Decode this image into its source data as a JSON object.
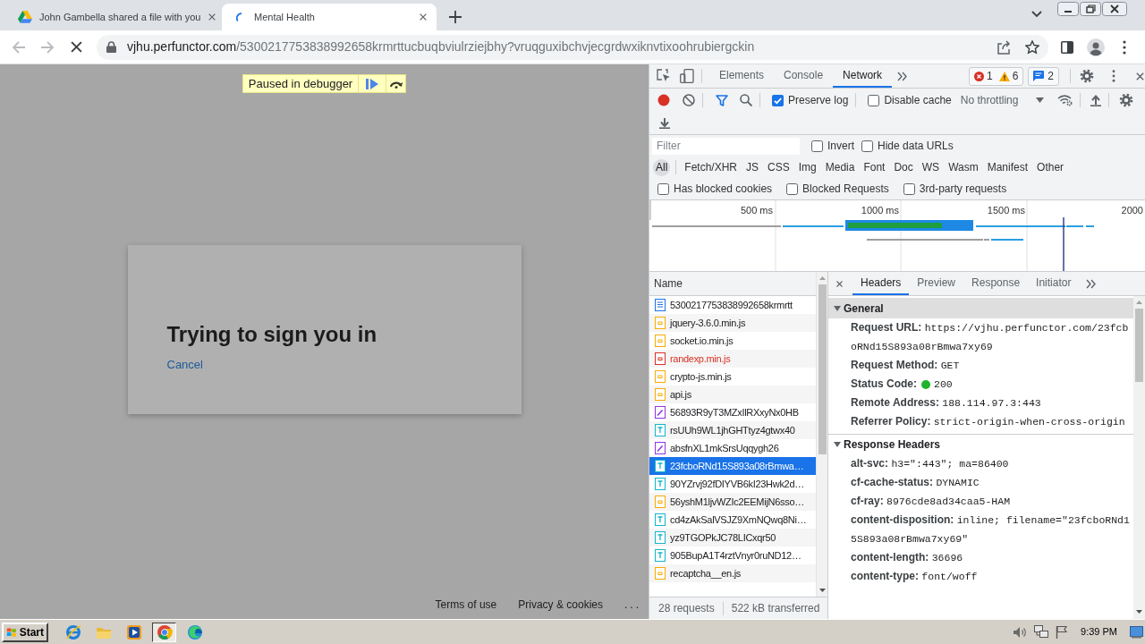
{
  "browser": {
    "tabs": [
      {
        "title": "John Gambella shared a file with you",
        "selected": false,
        "loading": false
      },
      {
        "title": "Mental Health",
        "selected": true,
        "loading": true
      }
    ],
    "loading": true,
    "address": {
      "host": "vjhu.perfunctor.com",
      "path": "/5300217753838992658krmrttucbuqbviulrziejbhy?vruqguxibchvjecgrdwxiknvtixoohrubiergckin"
    }
  },
  "page": {
    "debugger_banner": "Paused in debugger",
    "dialog": {
      "title": "Trying to sign you in",
      "link": "Cancel"
    },
    "footer": {
      "links": [
        "Terms of use",
        "Privacy & cookies"
      ],
      "more": "..."
    }
  },
  "devtools": {
    "tabs": [
      {
        "label": "Elements",
        "selected": false
      },
      {
        "label": "Console",
        "selected": false
      },
      {
        "label": "Network",
        "selected": true
      }
    ],
    "counts": {
      "errors": "1",
      "warnings": "6",
      "messages": "2"
    },
    "toolbar": {
      "recording": true,
      "options": [
        {
          "label": "Preserve log",
          "checked": true
        },
        {
          "label": "Disable cache",
          "checked": false
        }
      ],
      "throttling": "No throttling"
    },
    "filter": {
      "placeholder": "Filter",
      "options": [
        {
          "label": "Invert",
          "checked": false
        },
        {
          "label": "Hide data URLs",
          "checked": false
        }
      ]
    },
    "types": [
      {
        "label": "All",
        "selected": true
      },
      {
        "label": "Fetch/XHR",
        "selected": false
      },
      {
        "label": "JS",
        "selected": false
      },
      {
        "label": "CSS",
        "selected": false
      },
      {
        "label": "Img",
        "selected": false
      },
      {
        "label": "Media",
        "selected": false
      },
      {
        "label": "Font",
        "selected": false
      },
      {
        "label": "Doc",
        "selected": false
      },
      {
        "label": "WS",
        "selected": false
      },
      {
        "label": "Wasm",
        "selected": false
      },
      {
        "label": "Manifest",
        "selected": false
      },
      {
        "label": "Other",
        "selected": false
      }
    ],
    "request_filters": [
      {
        "label": "Has blocked cookies",
        "checked": false
      },
      {
        "label": "Blocked Requests",
        "checked": false
      },
      {
        "label": "3rd-party requests",
        "checked": false
      }
    ],
    "overview": {
      "ticks": [
        "500 ms",
        "1000 ms",
        "1500 ms",
        "2000"
      ]
    },
    "requests": {
      "column": "Name",
      "rows": [
        {
          "name": "5300217753838992658krmrtt",
          "kind": "document",
          "failed": false,
          "selected": false
        },
        {
          "name": "jquery-3.6.0.min.js",
          "kind": "script",
          "failed": false,
          "selected": false
        },
        {
          "name": "socket.io.min.js",
          "kind": "script",
          "failed": false,
          "selected": false
        },
        {
          "name": "randexp.min.js",
          "kind": "script",
          "failed": true,
          "selected": false
        },
        {
          "name": "crypto-js.min.js",
          "kind": "script",
          "failed": false,
          "selected": false
        },
        {
          "name": "api.js",
          "kind": "script",
          "failed": false,
          "selected": false
        },
        {
          "name": "56893R9yT3MZxIlRXxyNx0HB",
          "kind": "other",
          "failed": false,
          "selected": false
        },
        {
          "name": "rsUUh9WL1jhGHTtyz4gtwx40",
          "kind": "font",
          "failed": false,
          "selected": false
        },
        {
          "name": "absfnXL1mkSrsUqqygh26",
          "kind": "other",
          "failed": false,
          "selected": false
        },
        {
          "name": "23fcboRNd15S893a08rBmwa…",
          "kind": "font",
          "failed": false,
          "selected": true
        },
        {
          "name": "90YZrvj92fDIYVB6kI23Hwk2d…",
          "kind": "font",
          "failed": false,
          "selected": false
        },
        {
          "name": "56yshM1ljvWZIc2EEMijN6sso…",
          "kind": "script",
          "failed": false,
          "selected": false
        },
        {
          "name": "cd4zAkSalVSJZ9XmNQwq8Ni…",
          "kind": "font",
          "failed": false,
          "selected": false
        },
        {
          "name": "yz9TGOPkJC78LICxqr50",
          "kind": "font",
          "failed": false,
          "selected": false
        },
        {
          "name": "905BupA1T4rztVnyr0ruND12…",
          "kind": "font",
          "failed": false,
          "selected": false
        },
        {
          "name": "recaptcha__en.js",
          "kind": "script",
          "failed": false,
          "selected": false
        }
      ],
      "summary": [
        "28 requests",
        "522 kB transferred"
      ]
    },
    "details": {
      "tabs": [
        {
          "label": "Headers",
          "selected": true
        },
        {
          "label": "Preview",
          "selected": false
        },
        {
          "label": "Response",
          "selected": false
        },
        {
          "label": "Initiator",
          "selected": false
        }
      ],
      "sections": [
        {
          "title": "General",
          "expanded": true,
          "focused": true,
          "rows": [
            {
              "name": "Request URL:",
              "value": "https://vjhu.perfunctor.com/23fcboRNd15S893a08rBmwa7xy69"
            },
            {
              "name": "Request Method:",
              "value": "GET"
            },
            {
              "name": "Status Code:",
              "value": "200",
              "color": "#1db32a"
            },
            {
              "name": "Remote Address:",
              "value": "188.114.97.3:443"
            },
            {
              "name": "Referrer Policy:",
              "value": "strict-origin-when-cross-origin"
            }
          ]
        },
        {
          "title": "Response Headers",
          "expanded": true,
          "focused": false,
          "rows": [
            {
              "name": "alt-svc:",
              "value": "h3=\":443\"; ma=86400"
            },
            {
              "name": "cf-cache-status:",
              "value": "DYNAMIC"
            },
            {
              "name": "cf-ray:",
              "value": "8976cde8ad34caa5-HAM"
            },
            {
              "name": "content-disposition:",
              "value": "inline; filename=\"23fcboRNd15S893a08rBmwa7xy69\""
            },
            {
              "name": "content-length:",
              "value": "36696"
            },
            {
              "name": "content-type:",
              "value": "font/woff"
            }
          ]
        }
      ]
    }
  },
  "taskbar": {
    "start": "Start",
    "apps": [
      {
        "selected": false
      },
      {
        "selected": false
      },
      {
        "selected": false
      },
      {
        "selected": true
      },
      {
        "selected": false
      }
    ],
    "time": "9:39 PM"
  }
}
